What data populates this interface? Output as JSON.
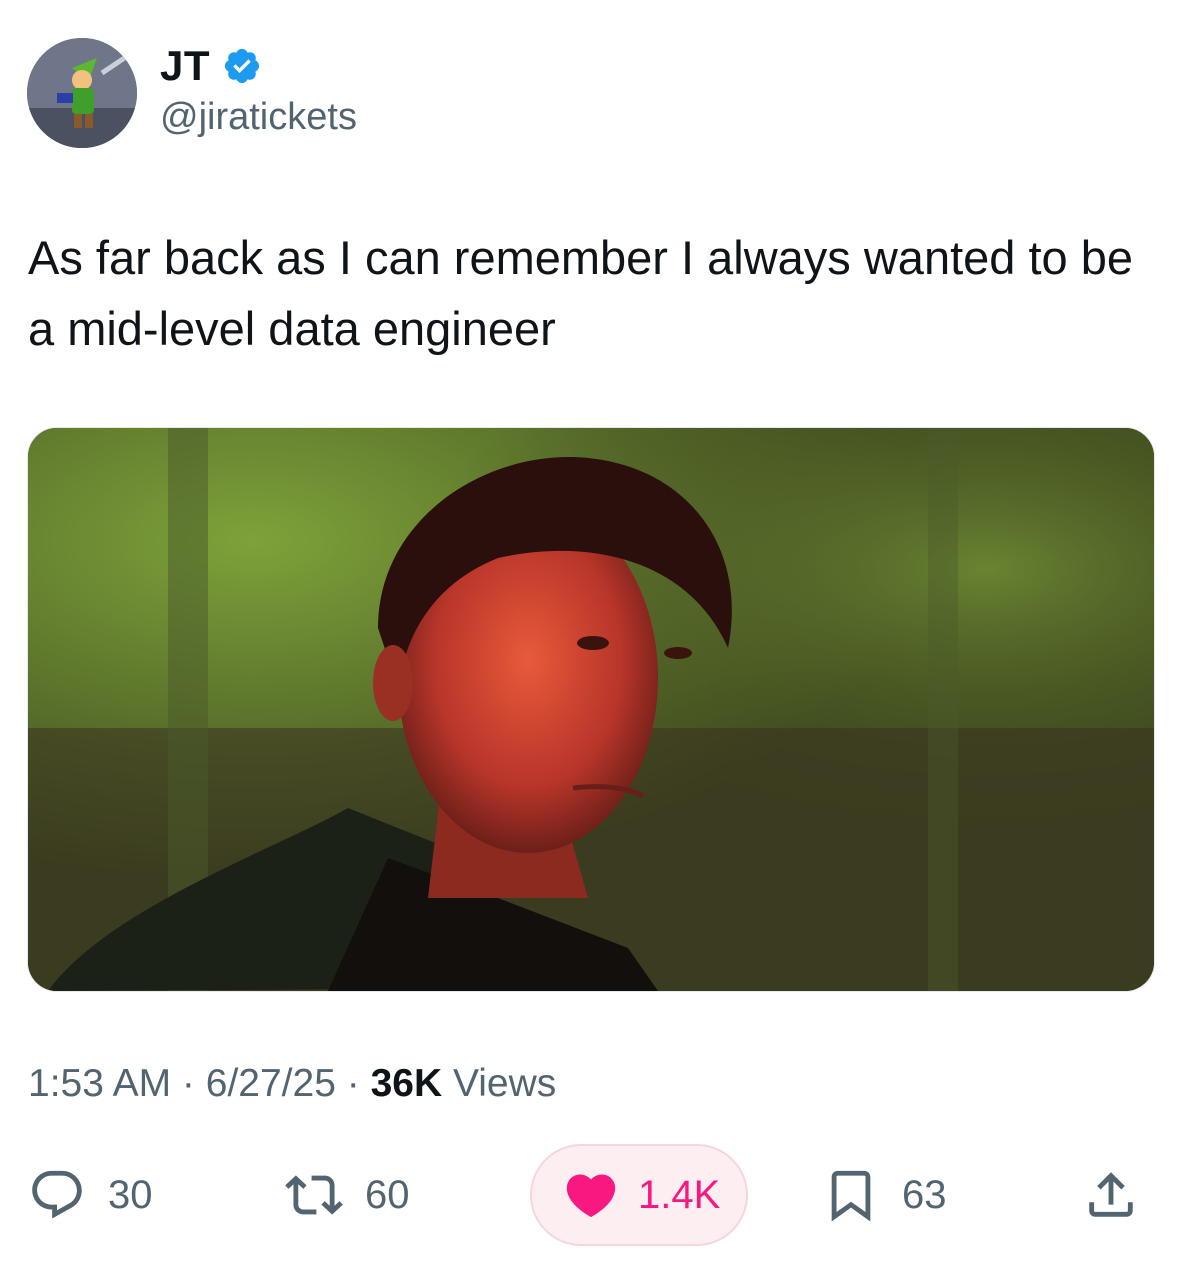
{
  "author": {
    "display_name": "JT",
    "handle": "@jiratickets",
    "verified": true,
    "verified_color": "#1d9bf0",
    "avatar_icon": "link-character-avatar"
  },
  "tweet": {
    "text": "As far back as I can remember I always wanted to be a mid-level data engineer",
    "media_icon": "man-in-forest-photo"
  },
  "meta": {
    "time": "1:53 AM",
    "sep1": " · ",
    "date": "6/27/25",
    "sep2": " · ",
    "views_count": "36K",
    "views_label": " Views"
  },
  "actions": {
    "replies": "30",
    "reposts": "60",
    "likes": "1.4K",
    "bookmarks": "63",
    "like_color": "#f91880",
    "muted_color": "#536471"
  }
}
